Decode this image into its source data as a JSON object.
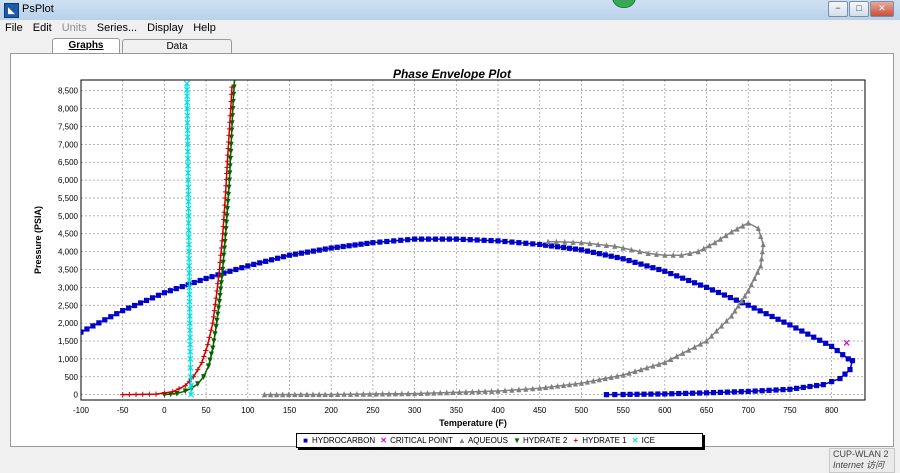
{
  "window": {
    "title": "PsPlot",
    "app_icon": "psplot-app-icon",
    "controls": {
      "minimize": "−",
      "maximize": "□",
      "close": "✕"
    }
  },
  "menu": [
    {
      "label": "File",
      "enabled": true
    },
    {
      "label": "Edit",
      "enabled": true
    },
    {
      "label": "Units",
      "enabled": false
    },
    {
      "label": "Series...",
      "enabled": true
    },
    {
      "label": "Display",
      "enabled": true
    },
    {
      "label": "Help",
      "enabled": true
    }
  ],
  "tabs": [
    {
      "label": "Graphs",
      "active": true
    },
    {
      "label": "Data",
      "active": false
    }
  ],
  "tray": {
    "network": "CUP-WLAN 2",
    "status": "Internet 访问"
  },
  "chart_data": {
    "type": "line",
    "title": "Phase Envelope Plot",
    "xlabel": "Temperature (F)",
    "ylabel": "Pressure (PSIA)",
    "xlim": [
      -100,
      840
    ],
    "ylim": [
      -150,
      8800
    ],
    "xticks": [
      "-100",
      "-50",
      "0",
      "50",
      "100",
      "150",
      "200",
      "250",
      "300",
      "350",
      "400",
      "450",
      "500",
      "550",
      "600",
      "650",
      "700",
      "750",
      "800"
    ],
    "yticks": [
      "0",
      "500",
      "1,000",
      "1,500",
      "2,000",
      "2,500",
      "3,000",
      "3,500",
      "4,000",
      "4,500",
      "5,000",
      "5,500",
      "6,000",
      "6,500",
      "7,000",
      "7,500",
      "8,000",
      "8,500"
    ],
    "grid": true,
    "legend_position": "bottom",
    "series": [
      {
        "name": "HYDROCARBON",
        "color": "#0000c8",
        "marker": "square",
        "x": [
          -100,
          -50,
          0,
          50,
          100,
          150,
          200,
          250,
          300,
          350,
          400,
          450,
          500,
          550,
          600,
          650,
          700,
          750,
          800,
          820,
          825,
          822,
          810,
          790,
          750,
          700,
          650,
          600,
          550,
          530
        ],
        "y": [
          1750,
          2350,
          2850,
          3250,
          3600,
          3900,
          4100,
          4250,
          4350,
          4350,
          4300,
          4200,
          4050,
          3800,
          3450,
          3000,
          2500,
          1950,
          1350,
          1000,
          950,
          700,
          450,
          280,
          150,
          90,
          50,
          20,
          5,
          0
        ]
      },
      {
        "name": "CRITICAL POINT",
        "color": "#e000e0",
        "marker": "x",
        "x": [
          818
        ],
        "y": [
          1450
        ]
      },
      {
        "name": "AQUEOUS",
        "color": "#808080",
        "marker": "triangle",
        "x": [
          120,
          200,
          300,
          400,
          450,
          500,
          550,
          600,
          650,
          680,
          700,
          715,
          718,
          712,
          700,
          680,
          660,
          640,
          620,
          600,
          580,
          560,
          540,
          520,
          500,
          480,
          460
        ],
        "y": [
          0,
          5,
          30,
          100,
          180,
          320,
          550,
          900,
          1500,
          2200,
          2900,
          3600,
          4200,
          4650,
          4800,
          4550,
          4250,
          4000,
          3900,
          3900,
          3950,
          4050,
          4150,
          4200,
          4250,
          4270,
          4280
        ]
      },
      {
        "name": "HYDRATE 2",
        "color": "#006400",
        "marker": "triangle-down",
        "x": [
          0,
          15,
          25,
          33,
          40,
          47,
          53,
          58,
          62,
          66,
          69,
          72,
          75,
          78,
          80,
          82,
          84
        ],
        "y": [
          0,
          30,
          100,
          180,
          300,
          500,
          800,
          1300,
          1900,
          2600,
          3300,
          4100,
          5000,
          6000,
          7000,
          8000,
          8800
        ]
      },
      {
        "name": "HYDRATE 1",
        "color": "#d00000",
        "marker": "plus",
        "x": [
          -50,
          -10,
          10,
          25,
          35,
          45,
          52,
          58,
          62,
          66,
          70,
          73,
          76,
          79,
          81
        ],
        "y": [
          0,
          15,
          80,
          250,
          500,
          900,
          1400,
          2000,
          2700,
          3500,
          4500,
          5500,
          6700,
          7800,
          8600
        ]
      },
      {
        "name": "ICE",
        "color": "#00e0e0",
        "marker": "x",
        "x": [
          32,
          31.5,
          31,
          30.5,
          30,
          29.5,
          29,
          28.5,
          28,
          27.5,
          27
        ],
        "y": [
          0,
          500,
          1000,
          2000,
          3000,
          4000,
          5000,
          6000,
          7000,
          8000,
          8700
        ]
      }
    ]
  }
}
